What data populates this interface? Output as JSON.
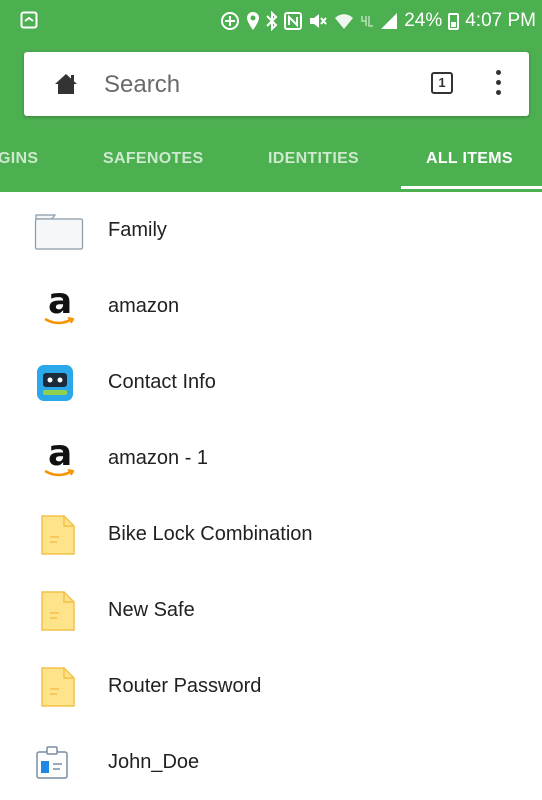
{
  "status_bar": {
    "battery": "24%",
    "time": "4:07 PM",
    "icons": [
      "screenshot-icon",
      "add-circle-icon",
      "location-icon",
      "bluetooth-icon",
      "nfc-icon",
      "mute-icon",
      "wifi-icon",
      "lte-icon",
      "signal-icon",
      "battery-icon"
    ]
  },
  "search": {
    "placeholder": "Search",
    "tab_count": "1"
  },
  "tabs": [
    {
      "label": "GINS",
      "active": false
    },
    {
      "label": "SAFENOTES",
      "active": false
    },
    {
      "label": "IDENTITIES",
      "active": false
    },
    {
      "label": "ALL ITEMS",
      "active": true
    }
  ],
  "items": [
    {
      "label": "Family",
      "icon": "folder-icon"
    },
    {
      "label": "amazon",
      "icon": "amazon-icon"
    },
    {
      "label": "Contact Info",
      "icon": "roboform-icon"
    },
    {
      "label": "amazon - 1",
      "icon": "amazon-icon"
    },
    {
      "label": "Bike Lock Combination",
      "icon": "safenote-icon"
    },
    {
      "label": "New Safe",
      "icon": "safenote-icon"
    },
    {
      "label": "Router Password",
      "icon": "safenote-icon"
    },
    {
      "label": "John_Doe",
      "icon": "identity-icon"
    }
  ],
  "colors": {
    "accent": "#4caf50",
    "note_fill": "#fde38a",
    "note_stroke": "#f5c04a"
  }
}
